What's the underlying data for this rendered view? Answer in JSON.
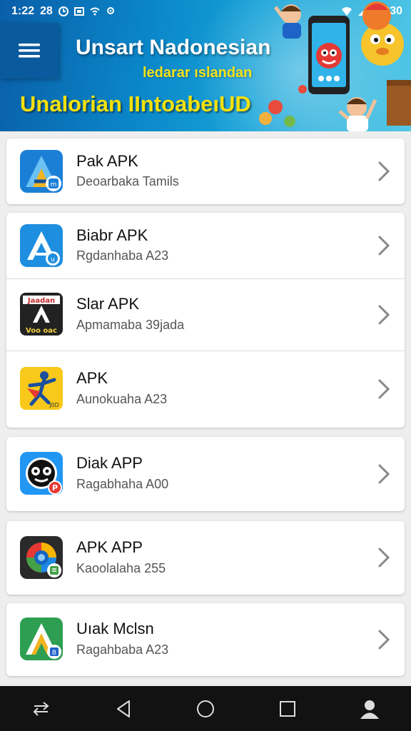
{
  "status_bar": {
    "time": "1:22",
    "left_indicators": "28",
    "battery_text": "2:830"
  },
  "banner": {
    "title": "Unsart Nadonesian",
    "subtitle": "ledarar ıslandan",
    "tagline": "Unalorian IIntoabeıUD"
  },
  "apps": [
    {
      "name": "Pak APK",
      "subtitle": "Deoarbaka Tamils",
      "icon": "blue-a-icon"
    },
    {
      "name": "Biabr APK",
      "subtitle": "Rgdanhaba A23",
      "icon": "blue-a-outline-icon"
    },
    {
      "name": "Slar APK",
      "subtitle": "Apmamaba 39jada",
      "icon": "dark-a-icon",
      "icon_text_top": "Jaadan",
      "icon_text_bottom": "Voo oac"
    },
    {
      "name": "APK",
      "subtitle": "Aunokuaha A23",
      "icon": "yellow-figure-icon",
      "icon_text": "J0D"
    },
    {
      "name": "Diak APP",
      "subtitle": "Ragabhaha A00",
      "icon": "face-p-icon"
    },
    {
      "name": "APK APP",
      "subtitle": "Kaoolalaha 255",
      "icon": "color-ring-icon"
    },
    {
      "name": "Uıak Mclsn",
      "subtitle": "Ragahbaba A23",
      "icon": "green-a-icon"
    }
  ],
  "nav": [
    "back-icon",
    "home-triangle-icon",
    "home-circle-icon",
    "recents-square-icon",
    "profile-icon"
  ],
  "colors": {
    "banner_blue": "#0a86c8",
    "banner_yellow": "#f4e10c",
    "list_bg": "#eeeeee",
    "nav_bg": "#121212"
  }
}
